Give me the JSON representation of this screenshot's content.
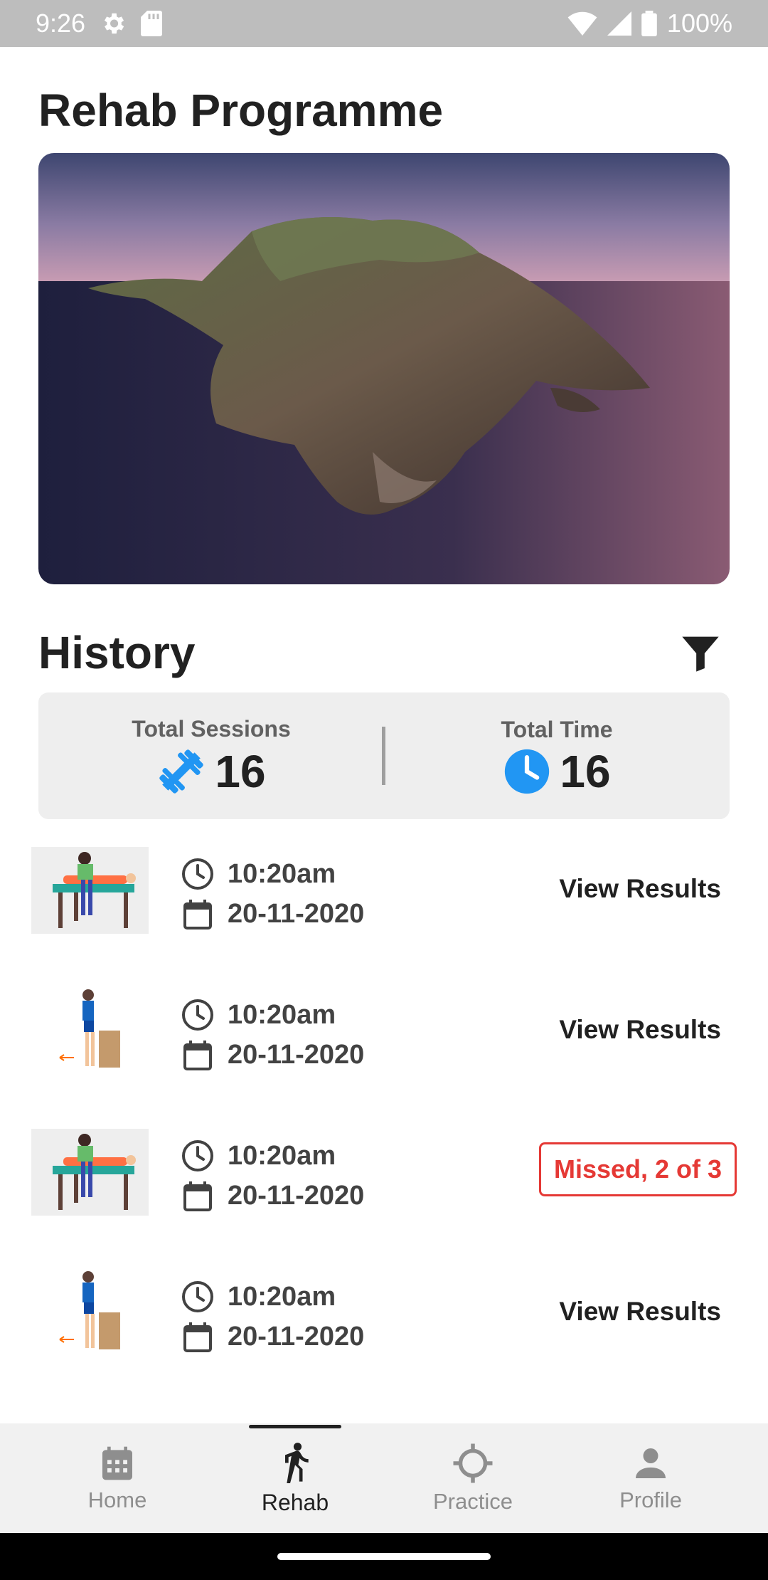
{
  "status_bar": {
    "time": "9:26",
    "battery": "100%",
    "icons": [
      "settings-icon",
      "sd-card-icon",
      "wifi-icon",
      "signal-icon",
      "battery-icon"
    ]
  },
  "page": {
    "title": "Rehab Programme"
  },
  "history": {
    "title": "History",
    "filter_icon": "filter-icon"
  },
  "stats": {
    "sessions_label": "Total Sessions",
    "sessions_value": "16",
    "time_label": "Total Time",
    "time_value": "16",
    "colors": {
      "accent": "#2196f3"
    }
  },
  "sessions": [
    {
      "time": "10:20am",
      "date": "20-11-2020",
      "action": "View Results",
      "thumb": "therapy-table"
    },
    {
      "time": "10:20am",
      "date": "20-11-2020",
      "action": "View Results",
      "thumb": "standing-exercise"
    },
    {
      "time": "10:20am",
      "date": "20-11-2020",
      "action": "Missed, 2 of 3",
      "thumb": "therapy-table",
      "missed": true
    },
    {
      "time": "10:20am",
      "date": "20-11-2020",
      "action": "View Results",
      "thumb": "standing-exercise"
    }
  ],
  "nav": {
    "items": [
      {
        "label": "Home",
        "icon": "calendar-icon"
      },
      {
        "label": "Rehab",
        "icon": "walking-icon"
      },
      {
        "label": "Practice",
        "icon": "crosshair-icon"
      },
      {
        "label": "Profile",
        "icon": "person-icon"
      }
    ],
    "active": "Rehab"
  },
  "colors": {
    "missed": "#e53935",
    "status_bar": "#bdbdbd",
    "nav_bg": "#f1f1f1"
  }
}
